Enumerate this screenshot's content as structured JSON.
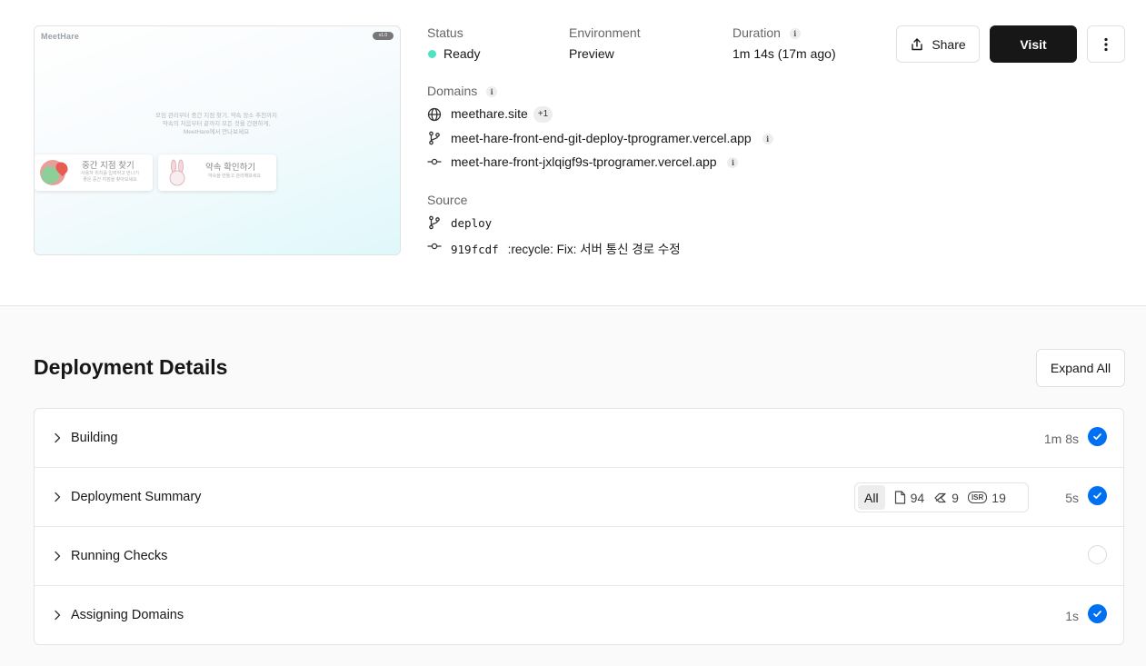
{
  "preview": {
    "logo": "MeetHare",
    "badge": "v1.0",
    "desc_lines": [
      "모임 관리부터 중간 지점 찾기, 약속 장소 추천까지",
      "약속의 처음부터 끝까지 모든 것을 간편하게,",
      "MeetHare에서 만나보세요"
    ],
    "card1_title": "중간 지점 찾기",
    "card1_sub": "사용자 위치를 입력하고 만나기\n좋은 중간 지점을 찾아보세요",
    "card2_title": "약속 확인하기",
    "card2_sub": "약속을 만들고 관리해보세요"
  },
  "status": {
    "label": "Status",
    "value": "Ready",
    "color": "#50e3c2"
  },
  "environment": {
    "label": "Environment",
    "value": "Preview"
  },
  "duration": {
    "label": "Duration",
    "value": "1m 14s (17m ago)"
  },
  "domains": {
    "label": "Domains",
    "primary": "meethare.site",
    "extra": "+1",
    "branch_url": "meet-hare-front-end-git-deploy-tprogramer.vercel.app",
    "commit_url": "meet-hare-front-jxlqigf9s-tprogramer.vercel.app"
  },
  "source": {
    "label": "Source",
    "branch": "deploy",
    "commit_hash": "919fcdf",
    "commit_message": ":recycle: Fix: 서버 통신 경로 수정"
  },
  "buttons": {
    "share": "Share",
    "visit": "Visit"
  },
  "details": {
    "title": "Deployment Details",
    "expand_all": "Expand All",
    "items": [
      {
        "label": "Building",
        "duration": "1m 8s",
        "state": "done"
      },
      {
        "label": "Deployment Summary",
        "duration": "5s",
        "state": "done"
      },
      {
        "label": "Running Checks",
        "duration": "",
        "state": "pending"
      },
      {
        "label": "Assigning Domains",
        "duration": "1s",
        "state": "done"
      }
    ],
    "summary": {
      "all": "All",
      "static": "94",
      "functions": "9",
      "isr_label": "ISR",
      "isr": "19"
    }
  },
  "colors": {
    "accent": "#0070f3",
    "primary_button": "#171717"
  }
}
